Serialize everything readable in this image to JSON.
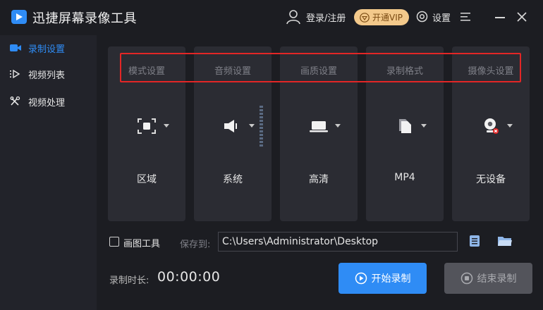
{
  "app": {
    "title": "迅捷屏幕录像工具"
  },
  "header": {
    "login_label": "登录/注册",
    "vip_label": "开通VIP",
    "settings_label": "设置"
  },
  "sidebar": {
    "items": [
      {
        "label": "录制设置",
        "active": true,
        "icon": "camera-icon"
      },
      {
        "label": "视频列表",
        "active": false,
        "icon": "list-icon"
      },
      {
        "label": "视频处理",
        "active": false,
        "icon": "tools-icon"
      }
    ]
  },
  "cards": [
    {
      "title": "模式设置",
      "value": "区域",
      "icon": "region-icon"
    },
    {
      "title": "音频设置",
      "value": "系统",
      "icon": "speaker-icon"
    },
    {
      "title": "画质设置",
      "value": "高清",
      "icon": "laptop-icon"
    },
    {
      "title": "录制格式",
      "value": "MP4",
      "icon": "file-icon"
    },
    {
      "title": "摄像头设置",
      "value": "无设备",
      "icon": "webcam-icon"
    }
  ],
  "bottom": {
    "draw_tool_label": "画图工具",
    "draw_tool_checked": false,
    "save_to_label": "保存到:",
    "save_path": "C:\\Users\\Administrator\\Desktop",
    "duration_label": "录制时长:",
    "duration_value": "00:00:00",
    "start_label": "开始录制",
    "stop_label": "结束录制"
  },
  "colors": {
    "accent": "#2f8cf5",
    "vip": "#f3c98b",
    "highlight": "#e32626",
    "background": "#1c1d22",
    "card": "#2b2c33"
  }
}
